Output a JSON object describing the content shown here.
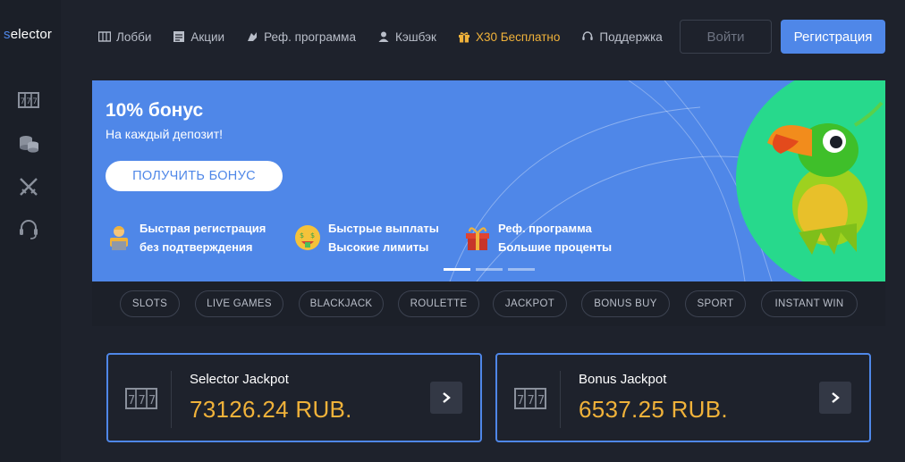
{
  "brand": {
    "logo_initial": "s",
    "logo_rest": "elector"
  },
  "nav": [
    {
      "label": "Лобби",
      "icon": "lobby-icon"
    },
    {
      "label": "Акции",
      "icon": "promotions-icon"
    },
    {
      "label": "Реф. программа",
      "icon": "referral-icon"
    },
    {
      "label": "Кэшбэк",
      "icon": "user-icon"
    },
    {
      "label": "X30 Бесплатно",
      "icon": "gift-icon"
    },
    {
      "label": "Поддержка",
      "icon": "headset-icon"
    }
  ],
  "auth": {
    "login": "Войти",
    "register": "Регистрация"
  },
  "sidebar": [
    {
      "icon": "slots-icon"
    },
    {
      "icon": "coins-icon"
    },
    {
      "icon": "crossed-swords-icon"
    },
    {
      "icon": "headset-icon"
    }
  ],
  "banner": {
    "title": "10% бонус",
    "subtitle": "На каждый депозит!",
    "cta": "ПОЛУЧИТЬ БОНУС",
    "features": [
      {
        "line1": "Быстрая регистрация",
        "line2": "без подтверждения",
        "icon": "person-laptop-icon"
      },
      {
        "line1": "Быстрые выплаты",
        "line2": "Высокие лимиты",
        "icon": "money-face-icon"
      },
      {
        "line1": "Реф. программа",
        "line2": "Большие проценты",
        "icon": "gift-box-icon"
      }
    ],
    "slides": {
      "count": 3,
      "active": 0
    }
  },
  "categories": [
    "SLOTS",
    "LIVE GAMES",
    "BLACKJACK",
    "ROULETTE",
    "JACKPOT",
    "BONUS BUY",
    "SPORT",
    "INSTANT WIN"
  ],
  "jackpots": [
    {
      "title": "Selector Jackpot",
      "amount": "73126.24 RUB."
    },
    {
      "title": "Bonus Jackpot",
      "amount": "6537.25 RUB."
    }
  ],
  "colors": {
    "accent": "#4f87e8",
    "gold": "#f0b23a",
    "background": "#1e222c",
    "promo_green": "#27d98c"
  }
}
